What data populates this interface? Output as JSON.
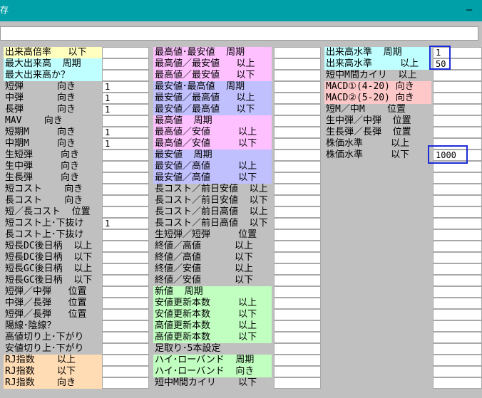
{
  "window": {
    "title": "存",
    "minimize_glyph": "—"
  },
  "colors": {
    "titlebar": "#00a0a8",
    "yellow": "#ffffc0",
    "cyan": "#c0ffff",
    "pink": "#ffc0ff",
    "violet": "#c0c0ff",
    "green": "#c0ffc0",
    "salmon": "#ffc8c8",
    "peach": "#ffdcb4",
    "selection_border": "#1e2bd8"
  },
  "col1": [
    {
      "label": "出来高倍率   以下",
      "color": "yellow",
      "value": ""
    },
    {
      "label": "最大出来高  周期",
      "color": "cyan",
      "value": ""
    },
    {
      "label": "最大出来高か？",
      "color": "cyan",
      "value": ""
    },
    {
      "label": "短弾      向き",
      "color": "",
      "value": "1"
    },
    {
      "label": "中弾      向き",
      "color": "",
      "value": "1"
    },
    {
      "label": "長弾      向き",
      "color": "",
      "value": "1"
    },
    {
      "label": "MAV    向き",
      "color": "",
      "value": ""
    },
    {
      "label": "短期M     向き",
      "color": "",
      "value": "1"
    },
    {
      "label": "中期M     向き",
      "color": "",
      "value": "1"
    },
    {
      "label": "生短弾     向き",
      "color": "",
      "value": ""
    },
    {
      "label": "生中弾     向き",
      "color": "",
      "value": ""
    },
    {
      "label": "生長弾     向き",
      "color": "",
      "value": ""
    },
    {
      "label": "短コスト    向き",
      "color": "",
      "value": ""
    },
    {
      "label": "長コスト    向き",
      "color": "",
      "value": ""
    },
    {
      "label": "短／長コスト  位置",
      "color": "",
      "value": ""
    },
    {
      "label": "短コスト上･下抜け",
      "color": "",
      "value": "1"
    },
    {
      "label": "長コスト上･下抜け",
      "color": "",
      "value": ""
    },
    {
      "label": "短長DC後日柄  以上",
      "color": "",
      "value": ""
    },
    {
      "label": "短長DC後日柄  以下",
      "color": "",
      "value": ""
    },
    {
      "label": "短長GC後日柄  以上",
      "color": "",
      "value": ""
    },
    {
      "label": "短長GC後日柄  以下",
      "color": "",
      "value": ""
    },
    {
      "label": "短弾／中弾   位置",
      "color": "",
      "value": ""
    },
    {
      "label": "中弾／長弾   位置",
      "color": "",
      "value": ""
    },
    {
      "label": "短弾／長弾   位置",
      "color": "",
      "value": ""
    },
    {
      "label": "陽線･陰線？",
      "color": "",
      "value": ""
    },
    {
      "label": "高値切り上･下がり",
      "color": "",
      "value": ""
    },
    {
      "label": "安値切り上･下がり",
      "color": "",
      "value": ""
    },
    {
      "label": "RJ指数    以上",
      "color": "peach",
      "value": ""
    },
    {
      "label": "RJ指数    以下",
      "color": "peach",
      "value": ""
    },
    {
      "label": "RJ指数    向き",
      "color": "peach",
      "value": ""
    }
  ],
  "col2": [
    {
      "label": "最高値･最安値  周期",
      "color": "pink",
      "value": ""
    },
    {
      "label": "最高値／最安値   以上",
      "color": "pink",
      "value": ""
    },
    {
      "label": "最高値／最安値   以下",
      "color": "pink",
      "value": ""
    },
    {
      "label": "最安値･最高値  周期",
      "color": "violet",
      "value": ""
    },
    {
      "label": "最安値／最高値   以上",
      "color": "violet",
      "value": ""
    },
    {
      "label": "最安値／最高値   以下",
      "color": "violet",
      "value": ""
    },
    {
      "label": "最高値  周期",
      "color": "pink",
      "value": ""
    },
    {
      "label": "最高値／安値     以上",
      "color": "pink",
      "value": ""
    },
    {
      "label": "最高値／安値     以下",
      "color": "pink",
      "value": ""
    },
    {
      "label": "最安値  周期",
      "color": "violet",
      "value": ""
    },
    {
      "label": "最安値／高値     以上",
      "color": "violet",
      "value": ""
    },
    {
      "label": "最安値／高値     以下",
      "color": "violet",
      "value": ""
    },
    {
      "label": "長コスト／前日安値  以上",
      "color": "",
      "value": ""
    },
    {
      "label": "長コスト／前日安値  以下",
      "color": "",
      "value": ""
    },
    {
      "label": "長コスト／前日高値  以上",
      "color": "",
      "value": ""
    },
    {
      "label": "長コスト／前日高値  以下",
      "color": "",
      "value": ""
    },
    {
      "label": "生短弾／短弾     位置",
      "color": "",
      "value": ""
    },
    {
      "label": "終値／高値      以上",
      "color": "",
      "value": ""
    },
    {
      "label": "終値／高値      以下",
      "color": "",
      "value": ""
    },
    {
      "label": "終値／安値      以上",
      "color": "",
      "value": ""
    },
    {
      "label": "終値／安値      以下",
      "color": "",
      "value": ""
    },
    {
      "label": "新値  周期",
      "color": "green",
      "value": ""
    },
    {
      "label": "安値更新本数     以上",
      "color": "green",
      "value": ""
    },
    {
      "label": "安値更新本数     以下",
      "color": "green",
      "value": ""
    },
    {
      "label": "高値更新本数     以上",
      "color": "green",
      "value": ""
    },
    {
      "label": "高値更新本数     以下",
      "color": "green",
      "value": ""
    },
    {
      "label": "足取り･5本設定",
      "color": "",
      "value": ""
    },
    {
      "label": "ハイ･ローバンド  周期",
      "color": "green",
      "value": ""
    },
    {
      "label": "ハイ･ローバンド  向き",
      "color": "green",
      "value": ""
    },
    {
      "label": "短中M間カイリ    以下",
      "color": "",
      "value": ""
    }
  ],
  "col3": [
    {
      "label": "出来高水準  周期",
      "color": "cyan",
      "value": "1"
    },
    {
      "label": "出来高水準     以上",
      "color": "cyan",
      "value": "50"
    },
    {
      "label": "短中M間カイリ  以上",
      "color": "",
      "value": ""
    },
    {
      "label": "MACD①(4-20) 向き",
      "color": "salmon",
      "value": ""
    },
    {
      "label": "MACD②(5-20) 向き",
      "color": "salmon",
      "value": ""
    },
    {
      "label": "短M／中M    位置",
      "color": "",
      "value": ""
    },
    {
      "label": "生中弾／中弾  位置",
      "color": "",
      "value": ""
    },
    {
      "label": "生長弾／長弾  位置",
      "color": "",
      "value": ""
    },
    {
      "label": "株価水準     以上",
      "color": "",
      "value": ""
    },
    {
      "label": "株価水準     以下",
      "color": "",
      "value": "1000"
    },
    {
      "label": "",
      "color": "",
      "value": ""
    },
    {
      "label": "",
      "color": "",
      "value": ""
    },
    {
      "label": "",
      "color": "",
      "value": ""
    },
    {
      "label": "",
      "color": "",
      "value": ""
    },
    {
      "label": "",
      "color": "",
      "value": ""
    },
    {
      "label": "",
      "color": "",
      "value": ""
    },
    {
      "label": "",
      "color": "",
      "value": ""
    },
    {
      "label": "",
      "color": "",
      "value": ""
    },
    {
      "label": "",
      "color": "",
      "value": ""
    },
    {
      "label": "",
      "color": "",
      "value": ""
    },
    {
      "label": "",
      "color": "",
      "value": ""
    },
    {
      "label": "",
      "color": "",
      "value": ""
    },
    {
      "label": "",
      "color": "",
      "value": ""
    },
    {
      "label": "",
      "color": "",
      "value": ""
    },
    {
      "label": "",
      "color": "",
      "value": ""
    },
    {
      "label": "",
      "color": "",
      "value": ""
    },
    {
      "label": "",
      "color": "",
      "value": ""
    },
    {
      "label": "",
      "color": "",
      "value": ""
    },
    {
      "label": "",
      "color": "",
      "value": ""
    },
    {
      "label": "",
      "color": "",
      "value": ""
    }
  ]
}
